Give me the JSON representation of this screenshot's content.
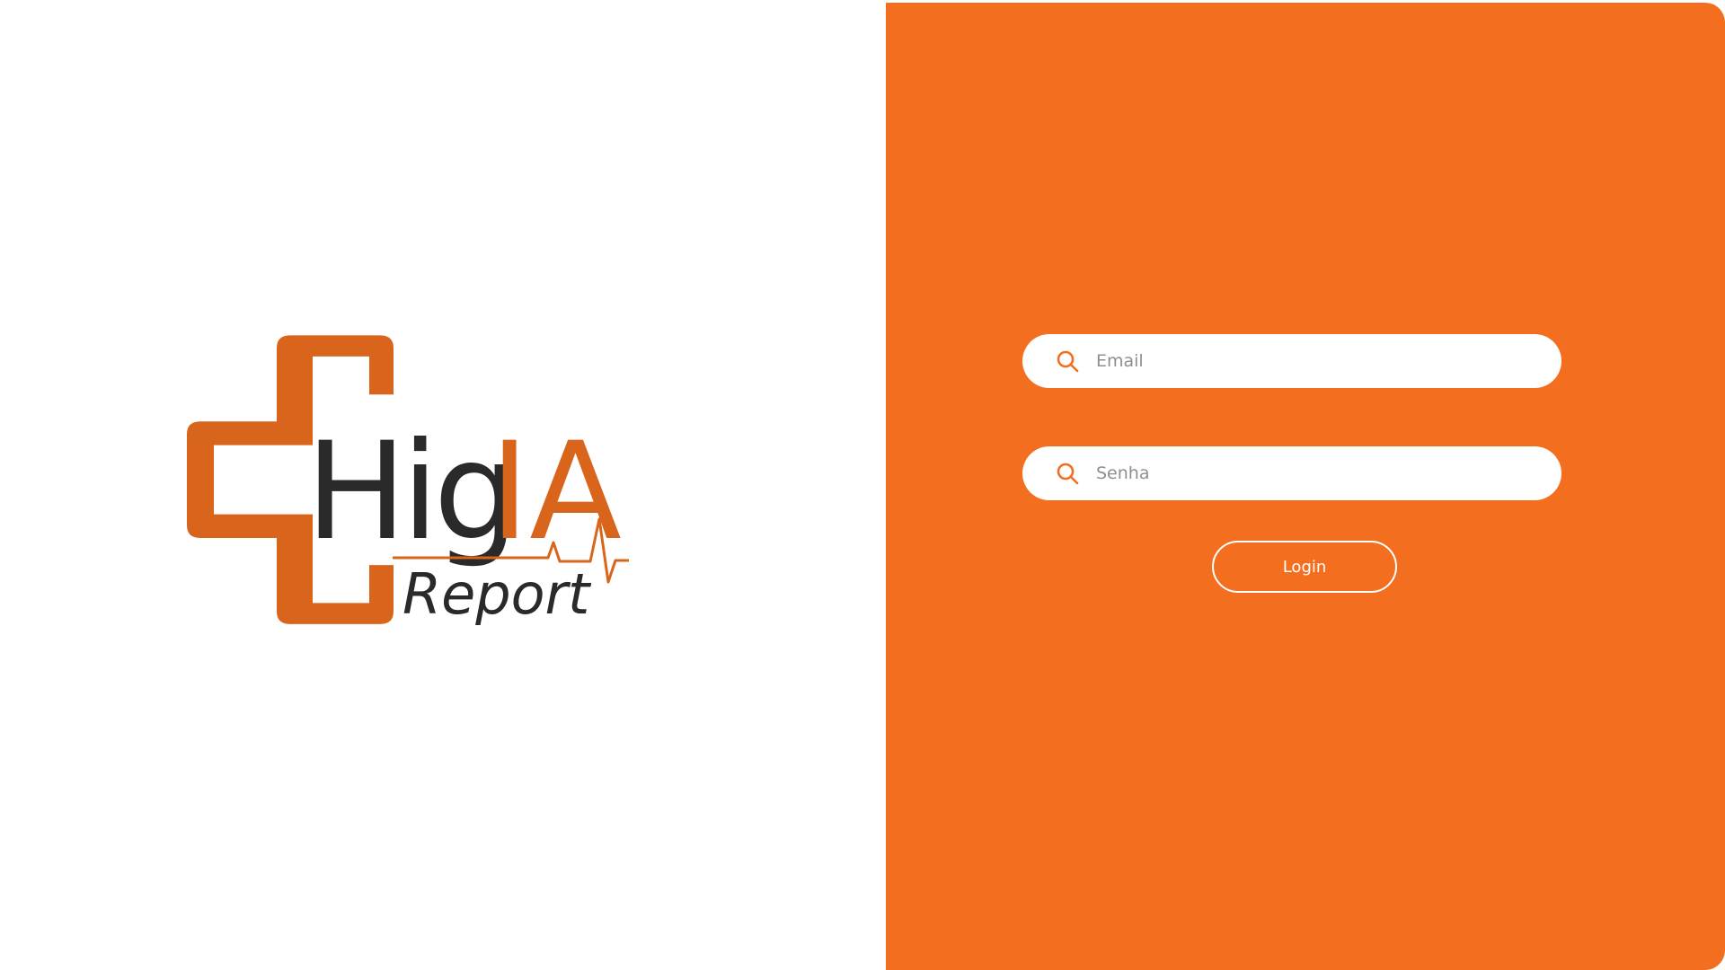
{
  "brand": {
    "logo_main": "HigIA",
    "logo_main_dark": "Hig",
    "logo_main_accent": "IA",
    "logo_sub": "Report",
    "accent_color": "#d9651c",
    "dark_color": "#2a2a2a"
  },
  "panel": {
    "background_color": "#f36f1f"
  },
  "form": {
    "email": {
      "placeholder": "Email",
      "value": "",
      "icon": "search-icon"
    },
    "password": {
      "placeholder": "Senha",
      "value": "",
      "icon": "search-icon"
    },
    "login_label": "Login"
  }
}
